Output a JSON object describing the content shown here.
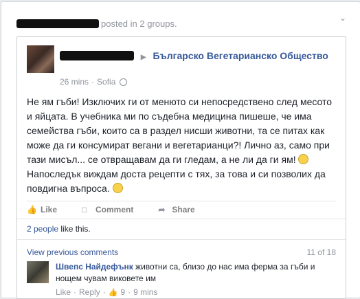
{
  "header": {
    "posted_text": "posted in 2 groups."
  },
  "post": {
    "group_name": "Българско Вегетарианско Общество",
    "time": "26 mins",
    "location": "Sofia",
    "meta_sep": "·",
    "text_part1": "Не ям гъби! Изключих ги от менюто си непосредствено след месото и яйцата. В учебника ми по съдебна медицина пишеше, че има семейства гъби, които са в раздел нисши животни, та се питах как може да ги консумират вегани и вегетарианци?! Лично аз, само при тази мисъл... се отвращавам да ги гледам, а не ли да ги ям!",
    "text_part2": "Напоследък виждам доста рецепти с тях, за това и си позволих да повдигна въпроса."
  },
  "actions": {
    "like": "Like",
    "comment": "Comment",
    "share": "Share"
  },
  "likes": {
    "count_link": "2 people",
    "suffix": " like this."
  },
  "comments": {
    "view_previous": "View previous comments",
    "counter": "11 of 18",
    "items": [
      {
        "name": "Швепс Найдефънк",
        "text": " животни са, близо до нас има ферма за гъби и нощем чувам виковете им",
        "like": "Like",
        "reply": "Reply",
        "likes": "9",
        "time": "9 mins",
        "dot": "·"
      }
    ]
  }
}
